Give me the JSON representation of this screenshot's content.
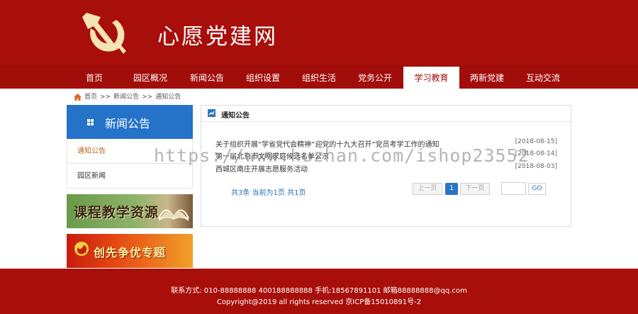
{
  "site": {
    "title": "心愿党建网"
  },
  "nav": [
    {
      "label": "首页"
    },
    {
      "label": "园区概况"
    },
    {
      "label": "新闻公告"
    },
    {
      "label": "组织设置"
    },
    {
      "label": "组织生活"
    },
    {
      "label": "党务公开"
    },
    {
      "label": "学习教育",
      "active": true
    },
    {
      "label": "两新党建"
    },
    {
      "label": "互动交流"
    }
  ],
  "breadcrumb": {
    "home": "首页",
    "sep": ">>",
    "level1": "新闻公告",
    "level2": "通知公告"
  },
  "sidebar": {
    "title": "新闻公告",
    "items": [
      {
        "label": "通知公告",
        "active": true
      },
      {
        "label": "园区新闻"
      }
    ],
    "banner1": "课程教学资源",
    "banner2": "创先争优专题"
  },
  "panel": {
    "title": "通知公告",
    "news": [
      {
        "title": "关于组织开展“学省党代会精神”迎党的十九大召开”党员考学工作的通知",
        "date": "[2018-08-15]"
      },
      {
        "title": "第一届北京市文明家庭候选名单公示",
        "date": "[2018-08-14]"
      },
      {
        "title": "西城区南庄开展志愿服务活动",
        "date": "[2018-08-03]"
      }
    ],
    "pager": {
      "info": "共3条 当前为1页 共1页",
      "prev": "上一页",
      "current": "1",
      "next": "下一页",
      "go": "GO"
    }
  },
  "watermark": "https://www.huzhan.com/ishop23552",
  "footer": {
    "contact": "联系方式: 010-88888888 400188888888 手机:18567891101 邮箱88888888@qq.com",
    "copyright": "Copyright@2019 all rights reserved 京ICP备15010891号-2"
  },
  "colors": {
    "brand_red": "#a80f0b",
    "blue": "#2573c8",
    "accent_orange": "#b5651d"
  }
}
